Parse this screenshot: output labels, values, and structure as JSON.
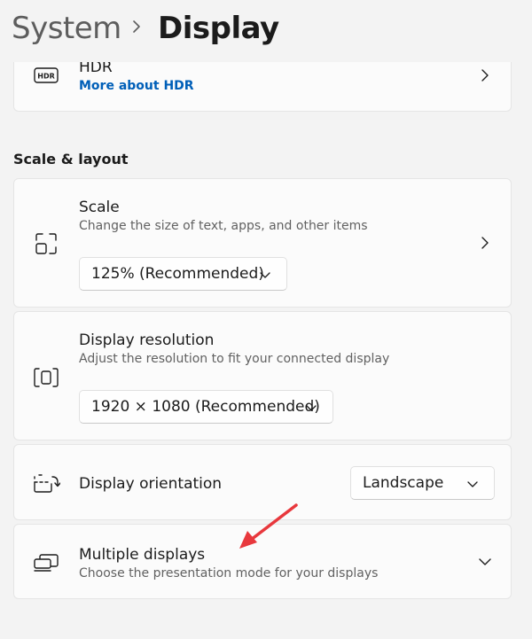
{
  "breadcrumb": {
    "parent": "System",
    "current": "Display"
  },
  "hdr": {
    "icon_text": "HDR",
    "title": "HDR",
    "link": "More about HDR"
  },
  "section_title": "Scale & layout",
  "scale": {
    "title": "Scale",
    "description": "Change the size of text, apps, and other items",
    "value": "125% (Recommended)"
  },
  "resolution": {
    "title": "Display resolution",
    "description": "Adjust the resolution to fit your connected display",
    "value": "1920 × 1080 (Recommended)"
  },
  "orientation": {
    "title": "Display orientation",
    "value": "Landscape"
  },
  "multiple_displays": {
    "title": "Multiple displays",
    "description": "Choose the presentation mode for your displays"
  },
  "colors": {
    "accent_link": "#005fb8",
    "annotation_arrow": "#e8383d"
  }
}
